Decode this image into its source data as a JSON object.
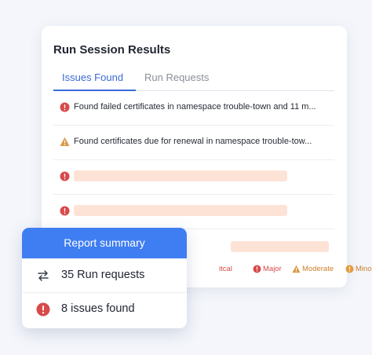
{
  "card": {
    "title": "Run Session Results",
    "tabs": [
      {
        "label": "Issues Found",
        "active": true
      },
      {
        "label": "Run Requests",
        "active": false
      }
    ],
    "issues": [
      {
        "severity": "major",
        "text": "Found failed certificates in namespace trouble-town and 11 m..."
      },
      {
        "severity": "moderate",
        "text": "Found certificates due for renewal in namespace trouble-tow..."
      },
      {
        "severity": "major",
        "text": ""
      },
      {
        "severity": "major",
        "text": ""
      }
    ],
    "legend": [
      {
        "label": "itcal",
        "icon": "none",
        "color": "#d84a4a"
      },
      {
        "label": "Major",
        "icon": "exclamation-circle-icon",
        "color": "#d84a4a"
      },
      {
        "label": "Moderate",
        "icon": "warning-triangle-icon",
        "color": "#d07e2a"
      },
      {
        "label": "Minor",
        "icon": "exclamation-circle-icon",
        "color": "#e39a3b"
      }
    ]
  },
  "summary": {
    "title": "Report summary",
    "rows": [
      {
        "icon": "swap-arrows-icon",
        "text": "35 Run requests"
      },
      {
        "icon": "exclamation-circle-icon",
        "text": "8 issues found"
      }
    ]
  },
  "colors": {
    "accent": "#3a6bd8",
    "header_blue": "#3f7ef2",
    "error_red": "#d84a4a",
    "warning_orange": "#d07e2a",
    "placeholder_peach": "#fde3d6"
  }
}
